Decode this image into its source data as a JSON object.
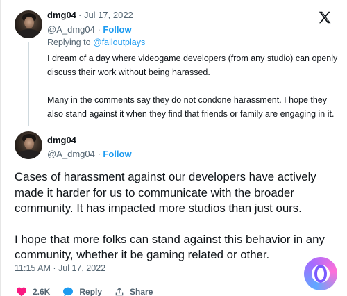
{
  "reply_tweet": {
    "display_name": "dmg04",
    "separator": " · ",
    "date": "Jul 17, 2022",
    "handle": "@A_dmg04",
    "dot": " · ",
    "follow_label": "Follow",
    "replying_prefix": "Replying to ",
    "replying_to": "@falloutplays",
    "paragraphs": [
      "I dream of a day where videogame developers (from any studio) can openly discuss their work without being harassed.",
      "Many in the comments say they do not condone harassment. I hope they also stand against it when they find that friends or family are engaging in it."
    ]
  },
  "main_tweet": {
    "display_name": "dmg04",
    "handle": "@A_dmg04",
    "dot": " · ",
    "follow_label": "Follow",
    "paragraphs": [
      "Cases of harassment against our developers have actively made it harder for us to communicate with the broader community. It has impacted more studios than just ours.",
      "I hope that more folks can stand against this behavior in any community, whether it be gaming related or other."
    ],
    "timestamp": "11:15 AM · Jul 17, 2022"
  },
  "actions": {
    "likes": "2.6K",
    "reply_label": "Reply",
    "share_label": "Share"
  },
  "icons": {
    "platform": "x-logo-icon",
    "like": "heart-icon",
    "reply": "speech-bubble-icon",
    "share": "share-icon",
    "watermark": "app-watermark-icon"
  },
  "colors": {
    "follow": "#1d9bf0",
    "heart": "#f91880",
    "reply": "#1d9bf0",
    "muted": "#536471",
    "text": "#0f1419"
  }
}
